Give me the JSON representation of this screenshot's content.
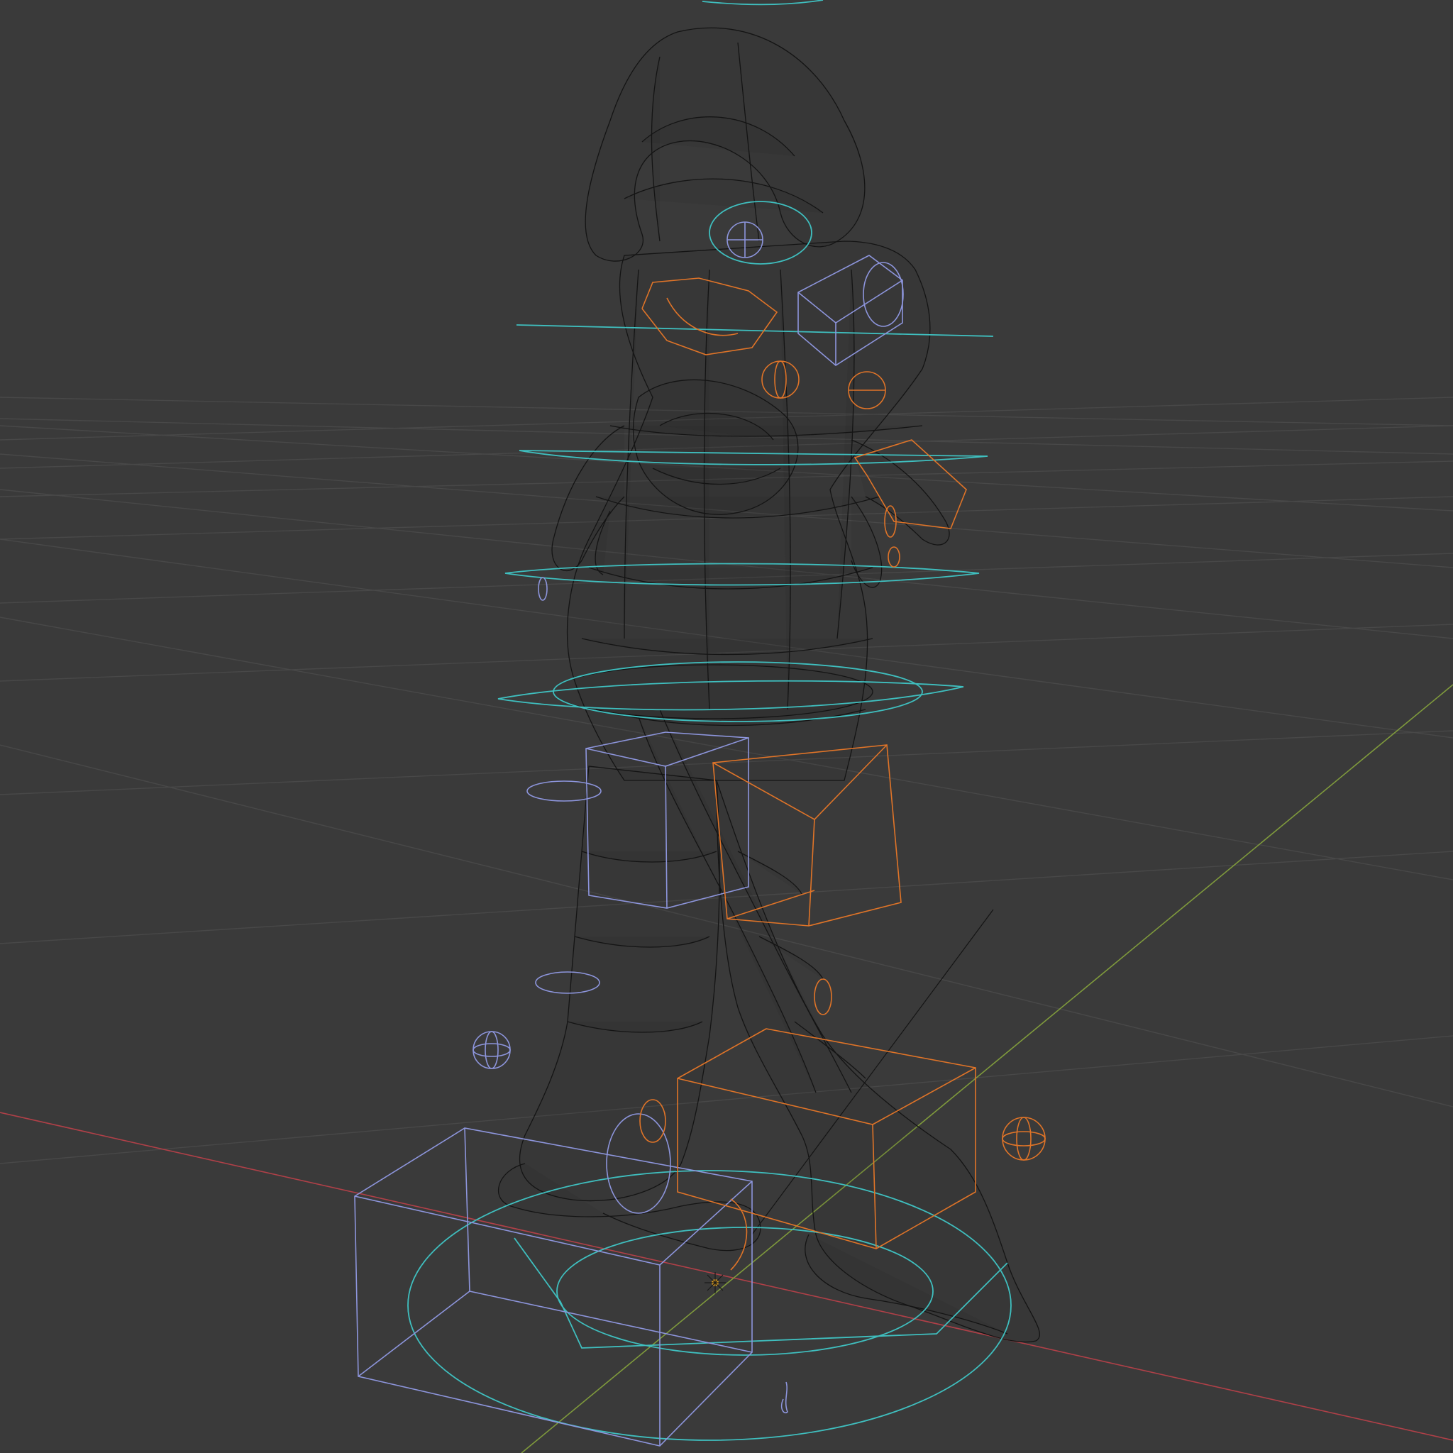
{
  "app": {
    "name": "3D viewport",
    "view_mode": "wireframe"
  },
  "viewport": {
    "background_color": "#3a3a3a",
    "grid_color": "#4a4a4a",
    "axis_x_color": "#c8484f",
    "axis_y_color": "#85a140",
    "wire_color": "#111111",
    "widget_cyan": "#3fbfbf",
    "widget_blue": "#8d95dc",
    "widget_orange": "#e07428",
    "origin_color": "#e0a020"
  },
  "icons": {
    "origin": "object-origin-icon",
    "mesh": "character-mesh-icon"
  }
}
